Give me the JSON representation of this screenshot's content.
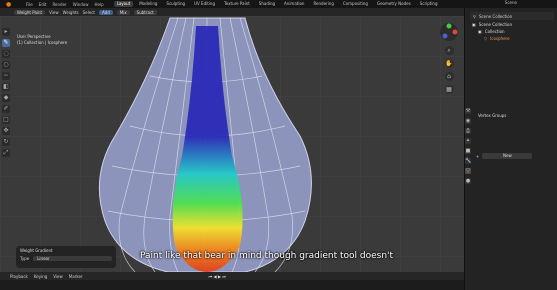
{
  "topbar": {
    "menu": [
      "File",
      "Edit",
      "Render",
      "Window",
      "Help"
    ],
    "tabs": [
      "Layout",
      "Modeling",
      "Sculpting",
      "UV Editing",
      "Texture Paint",
      "Shading",
      "Animation",
      "Rendering",
      "Compositing",
      "Geometry Nodes",
      "Scripting"
    ],
    "active_tab": "Layout",
    "scene_label": "Scene"
  },
  "viewport_header": {
    "mode": "Weight Paint",
    "items": [
      "View",
      "Weights",
      "Select"
    ],
    "buttons": [
      "Add",
      "Mix",
      "Subtract"
    ]
  },
  "viewport": {
    "info_line1": "User Perspective",
    "info_line2": "(1) Collection | Icosphere"
  },
  "gradient_panel": {
    "title": "Weight Gradient",
    "type_label": "Type",
    "type_value": "Linear"
  },
  "subtitle": "Paint like that bear in mind though gradient tool doesn't",
  "timeline": {
    "items": [
      "Playback",
      "Keying",
      "View",
      "Marker"
    ]
  },
  "outliner": {
    "header_label": "Scene Collection",
    "rows": [
      "Scene Collection",
      "Collection",
      "Icosphere"
    ]
  },
  "properties": {
    "title": "Vertex Groups",
    "new_button": "New"
  },
  "colors": {
    "viewport_bg": "#3a3a3a",
    "mesh_wire": "#9aa2c8",
    "accent_blue": "#4b6e9e"
  }
}
